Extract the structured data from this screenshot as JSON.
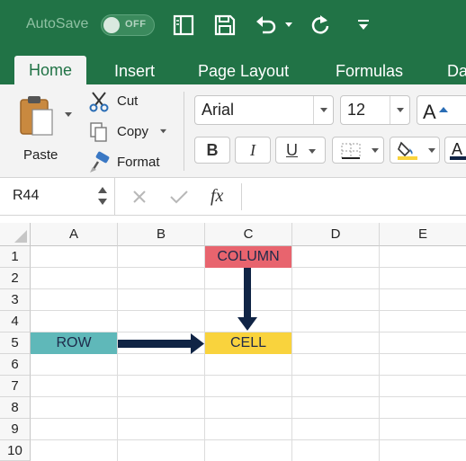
{
  "titlebar": {
    "autosave_label": "AutoSave",
    "autosave_state": "OFF",
    "icons": [
      "sidebar-icon",
      "save-icon",
      "undo-icon",
      "redo-icon",
      "customize-icon"
    ]
  },
  "tabs": [
    {
      "label": "Home",
      "active": true
    },
    {
      "label": "Insert",
      "active": false
    },
    {
      "label": "Page Layout",
      "active": false
    },
    {
      "label": "Formulas",
      "active": false
    },
    {
      "label": "Da",
      "active": false
    }
  ],
  "ribbon": {
    "paste_label": "Paste",
    "cut_label": "Cut",
    "copy_label": "Copy",
    "format_label": "Format",
    "font_name": "Arial",
    "font_size": "12",
    "bold_label": "B",
    "italic_label": "I",
    "underline_label": "U"
  },
  "formula_bar": {
    "name_box": "R44",
    "fx_label": "fx",
    "value": ""
  },
  "sheet": {
    "columns": [
      "A",
      "B",
      "C",
      "D",
      "E"
    ],
    "rows": [
      "1",
      "2",
      "3",
      "4",
      "5",
      "6",
      "7",
      "8",
      "9",
      "10"
    ],
    "cells": {
      "column_label": "COLUMN",
      "row_label": "ROW",
      "cell_label": "CELL"
    },
    "colors": {
      "column_fill": "#e8646e",
      "row_fill": "#5fb8b9",
      "cell_fill": "#f9d33d",
      "arrow": "#102445",
      "theme": "#217346"
    }
  }
}
